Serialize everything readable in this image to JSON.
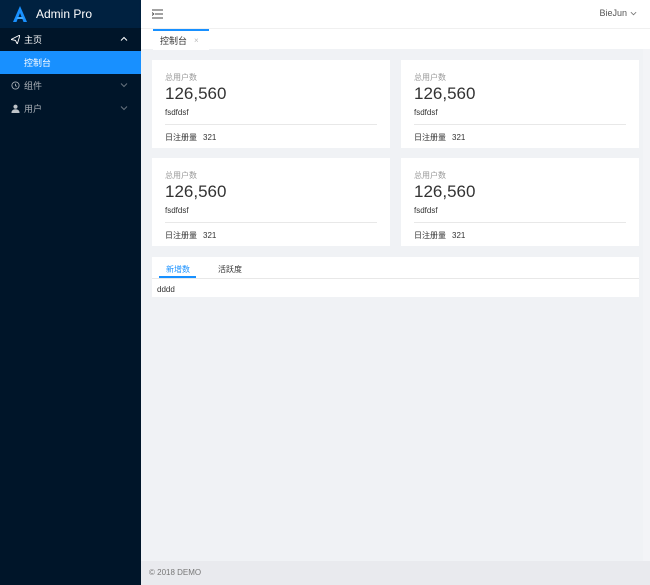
{
  "app": {
    "title": "Admin Pro",
    "brand_color": "#1890ff"
  },
  "sidebar": {
    "items": [
      {
        "label": "主页",
        "icon": "paper-plane-icon",
        "expanded": true,
        "children": [
          {
            "label": "控制台",
            "active": true
          }
        ]
      },
      {
        "label": "组件",
        "icon": "clock-circle-icon",
        "expanded": false
      },
      {
        "label": "用户",
        "icon": "user-icon",
        "expanded": false
      }
    ]
  },
  "header": {
    "user": "BieJun"
  },
  "tabbar": {
    "tabs": [
      {
        "label": "控制台",
        "close": "×"
      }
    ]
  },
  "cards": [
    {
      "label": "总用户数",
      "value": "126,560",
      "sub": "fsdfdsf",
      "footer_label": "日注册量",
      "footer_value": "321"
    },
    {
      "label": "总用户数",
      "value": "126,560",
      "sub": "fsdfdsf",
      "footer_label": "日注册量",
      "footer_value": "321"
    },
    {
      "label": "总用户数",
      "value": "126,560",
      "sub": "fsdfdsf",
      "footer_label": "日注册量",
      "footer_value": "321"
    },
    {
      "label": "总用户数",
      "value": "126,560",
      "sub": "fsdfdsf",
      "footer_label": "日注册量",
      "footer_value": "321"
    }
  ],
  "panel": {
    "tabs": [
      "新增数",
      "活跃度"
    ],
    "active_tab": 0,
    "content": "dddd"
  },
  "footer": {
    "text": "© 2018 DEMO"
  }
}
